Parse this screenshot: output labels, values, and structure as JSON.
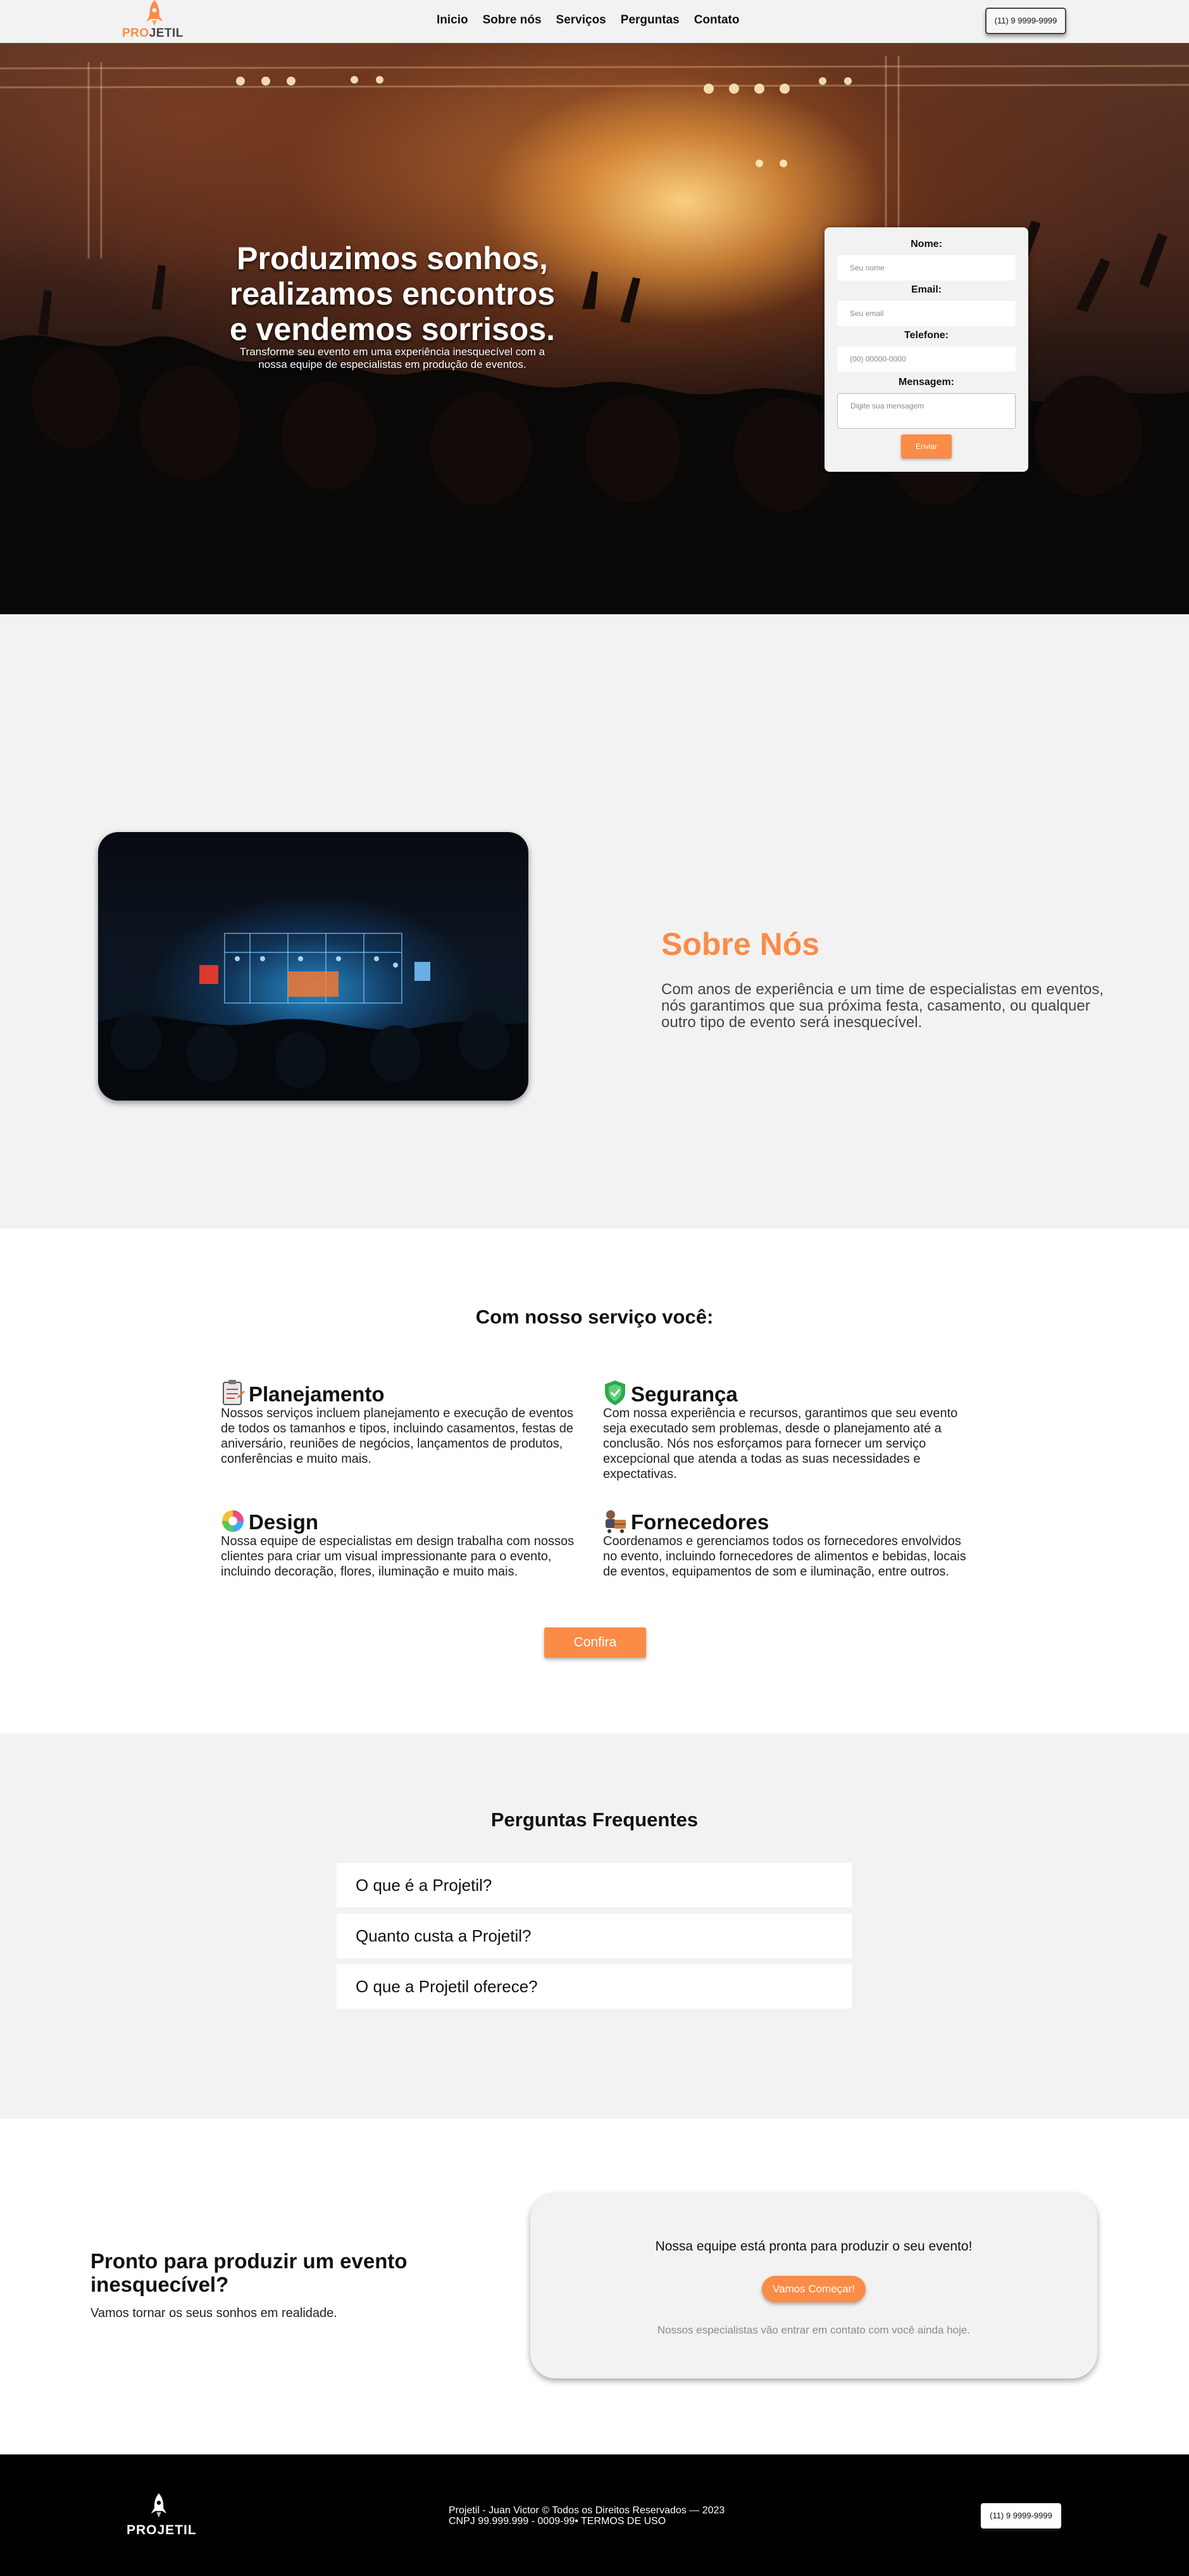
{
  "brand": {
    "logo_part1": "PRO",
    "logo_part2": "JETIL",
    "footer_logo": "PROJETIL",
    "accent_color": "#fb8c47"
  },
  "nav": {
    "items": [
      {
        "label": "Inicio"
      },
      {
        "label": "Sobre nós"
      },
      {
        "label": "Serviços"
      },
      {
        "label": "Perguntas"
      },
      {
        "label": "Contato"
      }
    ],
    "phone": "(11) 9 9999-9999"
  },
  "hero": {
    "title_line1": "Produzimos sonhos,",
    "title_line2": "realizamos encontros",
    "title_line3": "e vendemos sorrisos.",
    "subtitle": "Transforme seu evento em uma experiência inesquecível com a nossa equipe de especialistas em produção de eventos.",
    "form": {
      "name_label": "Nome:",
      "name_placeholder": "Seu nome",
      "email_label": "Email:",
      "email_placeholder": "Seu email",
      "phone_label": "Telefone:",
      "phone_placeholder": "(00) 00000-0000",
      "message_label": "Mensagem:",
      "message_placeholder": "Digite sua mensagem",
      "submit_label": "Enviar"
    }
  },
  "about": {
    "title": "Sobre Nós",
    "text": "Com anos de experiência e um time de especialistas em eventos, nós garantimos que sua próxima festa, casamento, ou qualquer outro tipo de evento será inesquecível."
  },
  "services": {
    "title": "Com nosso serviço você:",
    "items": [
      {
        "icon": "clipboard-icon",
        "title": "Planejamento",
        "text": "Nossos serviços incluem planejamento e execução de eventos de todos os tamanhos e tipos, incluindo casamentos, festas de aniversário, reuniões de negócios, lançamentos de produtos, conferências e muito mais."
      },
      {
        "icon": "shield-icon",
        "title": "Segurança",
        "text": "Com nossa experiência e recursos, garantimos que seu evento seja executado sem problemas, desde o planejamento até a conclusão. Nós nos esforçamos para fornecer um serviço excepcional que atenda a todas as suas necessidades e expectativas."
      },
      {
        "icon": "color-palette-icon",
        "title": "Design",
        "text": "Nossa equipe de especialistas em design trabalha com nossos clientes para criar um visual impressionante para o evento, incluindo decoração, flores, iluminação e muito mais."
      },
      {
        "icon": "supplier-icon",
        "title": "Fornecedores",
        "text": "Coordenamos e gerenciamos todos os fornecedores envolvidos no evento, incluindo fornecedores de alimentos e bebidas, locais de eventos, equipamentos de som e iluminação, entre outros."
      }
    ],
    "button_label": "Confira"
  },
  "faq": {
    "title": "Perguntas Frequentes",
    "items": [
      {
        "question": "O que é a Projetil?"
      },
      {
        "question": "Quanto custa a Projetil?"
      },
      {
        "question": "O que a Projetil oferece?"
      }
    ]
  },
  "cta": {
    "title": "Pronto para produzir um evento inesquecível?",
    "subtitle": "Vamos tornar os seus sonhos em realidade.",
    "card_text": "Nossa equipe está pronta para produzir o seu evento!",
    "button_label": "Vamos Começar!",
    "note": "Nossos especialistas vão entrar em contato com você ainda hoje."
  },
  "footer": {
    "copyright": "Projetil - Juan Victor © Todos os Direitos Reservados — 2023",
    "cnpj": "CNPJ 99.999.999 - 0009-99• TERMOS DE USO",
    "phone": "(11) 9 9999-9999"
  }
}
